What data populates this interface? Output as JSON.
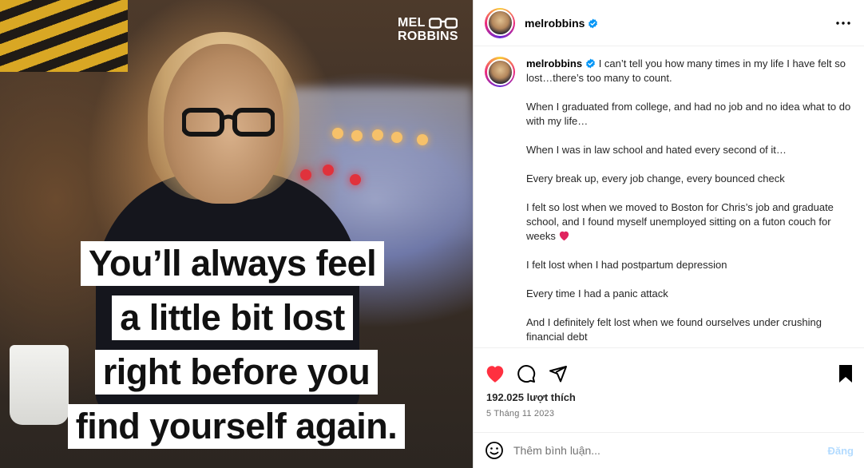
{
  "photo": {
    "brand_line1": "MEL",
    "brand_line2": "ROBBINS",
    "quote_lines": [
      "You’ll always feel",
      "a little bit lost",
      "right before you",
      "find yourself again."
    ]
  },
  "header": {
    "username": "melrobbins",
    "verified": true,
    "more_icon": "more-horizontal-icon"
  },
  "caption": {
    "username": "melrobbins",
    "first_line": " I can’t tell you how many times in my life I have felt so lost…there’s too many to count.",
    "paragraphs": [
      "When I graduated from college, and had no job and no idea what to do with my life…",
      "When I was in law school and hated every second of it…",
      "Every break up, every job change, every bounced check",
      "I felt so lost when we moved to Boston for Chris’s job and graduate school, and I found myself unemployed sitting on a futon couch for weeks",
      "I felt lost when I had postpartum depression",
      "Every time I had a panic attack",
      "And I definitely felt lost when we found ourselves under crushing financial debt"
    ]
  },
  "actions": {
    "like_icon": "heart-filled-icon",
    "comment_icon": "comment-icon",
    "share_icon": "share-icon",
    "save_icon": "bookmark-filled-icon",
    "like_color": "#ff3040"
  },
  "likes": "192.025 lượt thích",
  "date": "5 Tháng 11 2023",
  "comment_box": {
    "placeholder": "Thêm bình luận...",
    "post_label": "Đăng",
    "emoji_icon": "emoji-smiley-icon"
  }
}
